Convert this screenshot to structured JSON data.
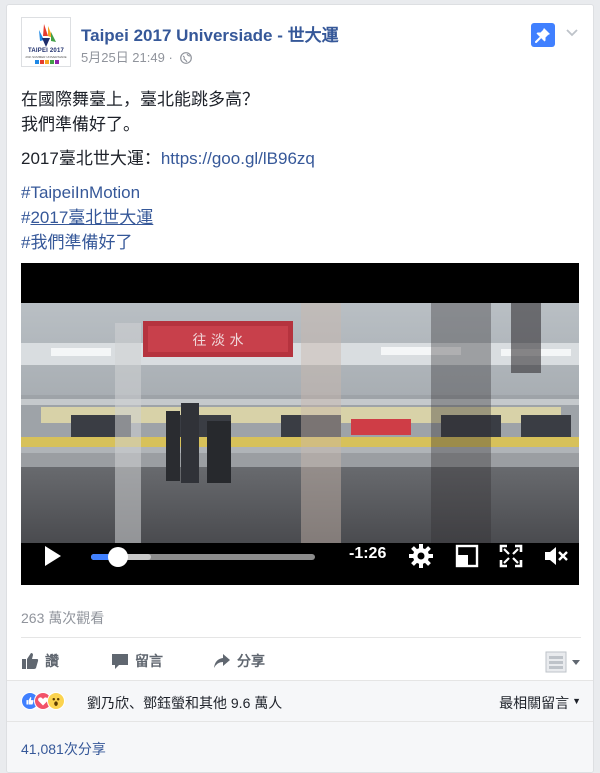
{
  "post": {
    "page_name": "Taipei 2017 Universiade - 世大運",
    "timestamp": "5月25日 21:49",
    "separator": " · ",
    "avatar": {
      "logo_text": "TAIPEI 2017",
      "logo_sub": "29th SUMMER UNIVERSIADE"
    },
    "text_lines": [
      "在國際舞臺上，臺北能跳多高？",
      "我們準備好了。"
    ],
    "link_prefix": "2017臺北世大運：",
    "link_url": "https://goo.gl/lB96zq",
    "hashtags": [
      "#TaipeiInMotion",
      "#",
      "2017臺北世大運",
      "#我們準備好了"
    ],
    "icons": {
      "pin": "pin-icon",
      "menu": "chevron-down-icon",
      "privacy": "globe-icon"
    }
  },
  "video": {
    "remaining_time": "-1:26",
    "progress_fraction": 0.12,
    "buffered_fraction": 0.27,
    "sign_text": "往 淡 水"
  },
  "stats": {
    "views": "263 萬次觀看"
  },
  "actions": {
    "like": "讚",
    "comment": "留言",
    "share": "分享"
  },
  "reactions": {
    "names": "劉乃欣、鄧鈺螢和其他 9.6 萬人",
    "sort_label": "最相關留言"
  },
  "shares": {
    "count": "41,081次分享"
  },
  "colors": {
    "brand_link": "#365899",
    "accent": "#4080ff",
    "meta_gray": "#90949c"
  }
}
